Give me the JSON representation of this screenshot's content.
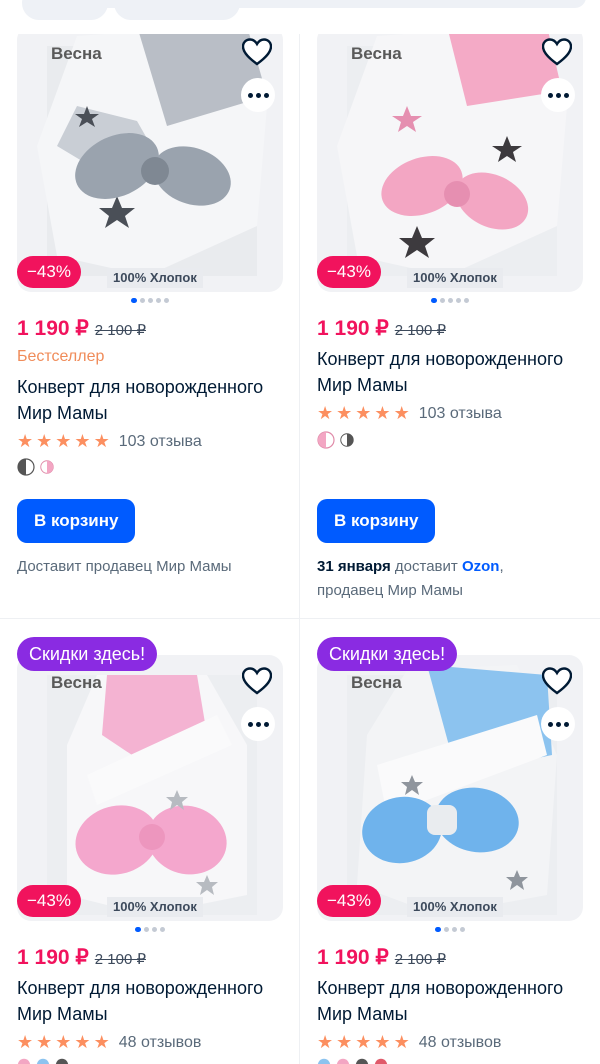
{
  "products": [
    {
      "season": "Весна",
      "discount": "−43%",
      "tag": "100% Хлопок",
      "price_now": "1 190 ₽",
      "price_old": "2 100 ₽",
      "bestseller": "Бестселлер",
      "title": "Конверт для новорожденного Мир Мамы",
      "reviews": "103 отзыва",
      "rating": 5,
      "cart_label": "В корзину",
      "delivery_text": "Доставит продавец Мир Мамы",
      "colors": {
        "bow": "#9aa3ae",
        "accent": "#d5d9df"
      }
    },
    {
      "season": "Весна",
      "discount": "−43%",
      "tag": "100% Хлопок",
      "price_now": "1 190 ₽",
      "price_old": "2 100 ₽",
      "title": "Конверт для новорожденного Мир Мамы",
      "reviews": "103 отзыва",
      "rating": 5,
      "cart_label": "В корзину",
      "delivery_date": "31 января",
      "delivery_mid": "доставит",
      "delivery_brand": "Ozon",
      "delivery_tail": ",",
      "delivery_line2": "продавец Мир Мамы",
      "colors": {
        "bow": "#f3a6c3",
        "accent": "#f6b9cf"
      }
    },
    {
      "sale_badge": "Скидки здесь!",
      "season": "Весна",
      "discount": "−43%",
      "tag": "100% Хлопок",
      "price_now": "1 190 ₽",
      "price_old": "2 100 ₽",
      "title": "Конверт для новорожденного Мир Мамы",
      "reviews": "48 отзывов",
      "rating": 5,
      "colors": {
        "bow": "#f4a7cd",
        "accent": "#f7b8d6"
      }
    },
    {
      "sale_badge": "Скидки здесь!",
      "season": "Весна",
      "discount": "−43%",
      "tag": "100% Хлопок",
      "price_now": "1 190 ₽",
      "price_old": "2 100 ₽",
      "title": "Конверт для новорожденного Мир Мамы",
      "reviews": "48 отзывов",
      "rating": 5,
      "colors": {
        "bow": "#6fb3ec",
        "accent": "#8cc3ef"
      }
    }
  ],
  "icons": {
    "favorite": "heart-outline-icon",
    "more": "more-dots-icon",
    "star": "star-icon"
  },
  "theme": {
    "primary": "#005bff",
    "price": "#f1135d",
    "sale_badge": "#8a2be2",
    "star": "#fc8f60"
  }
}
